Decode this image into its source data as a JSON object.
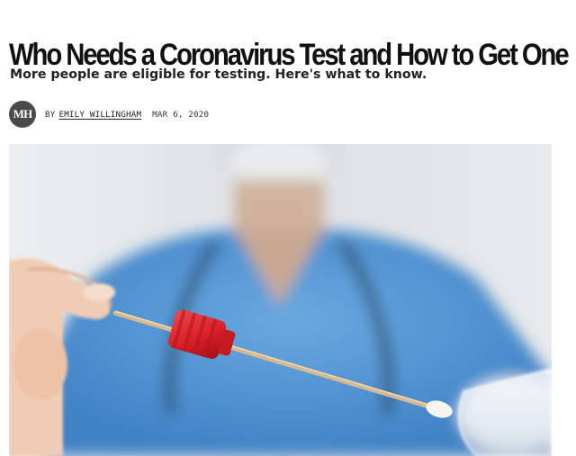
{
  "article": {
    "headline": "Who Needs a Coronavirus Test and How to Get One",
    "dek": "More people are eligible for testing. Here's what to know.",
    "logo_text": "MH",
    "by_prefix": "BY",
    "author": "EMILY WILLINGHAM",
    "date": "MAR 6, 2020"
  },
  "hero_image": {
    "subject": "Gloved hand holding a cotton swab with a red cap beside a test tube, medical worker in blue scrubs blurred in background",
    "colors": {
      "scrubs": "#4f93d3",
      "cap": "#d81e26",
      "background": "#e3e6e8"
    }
  }
}
